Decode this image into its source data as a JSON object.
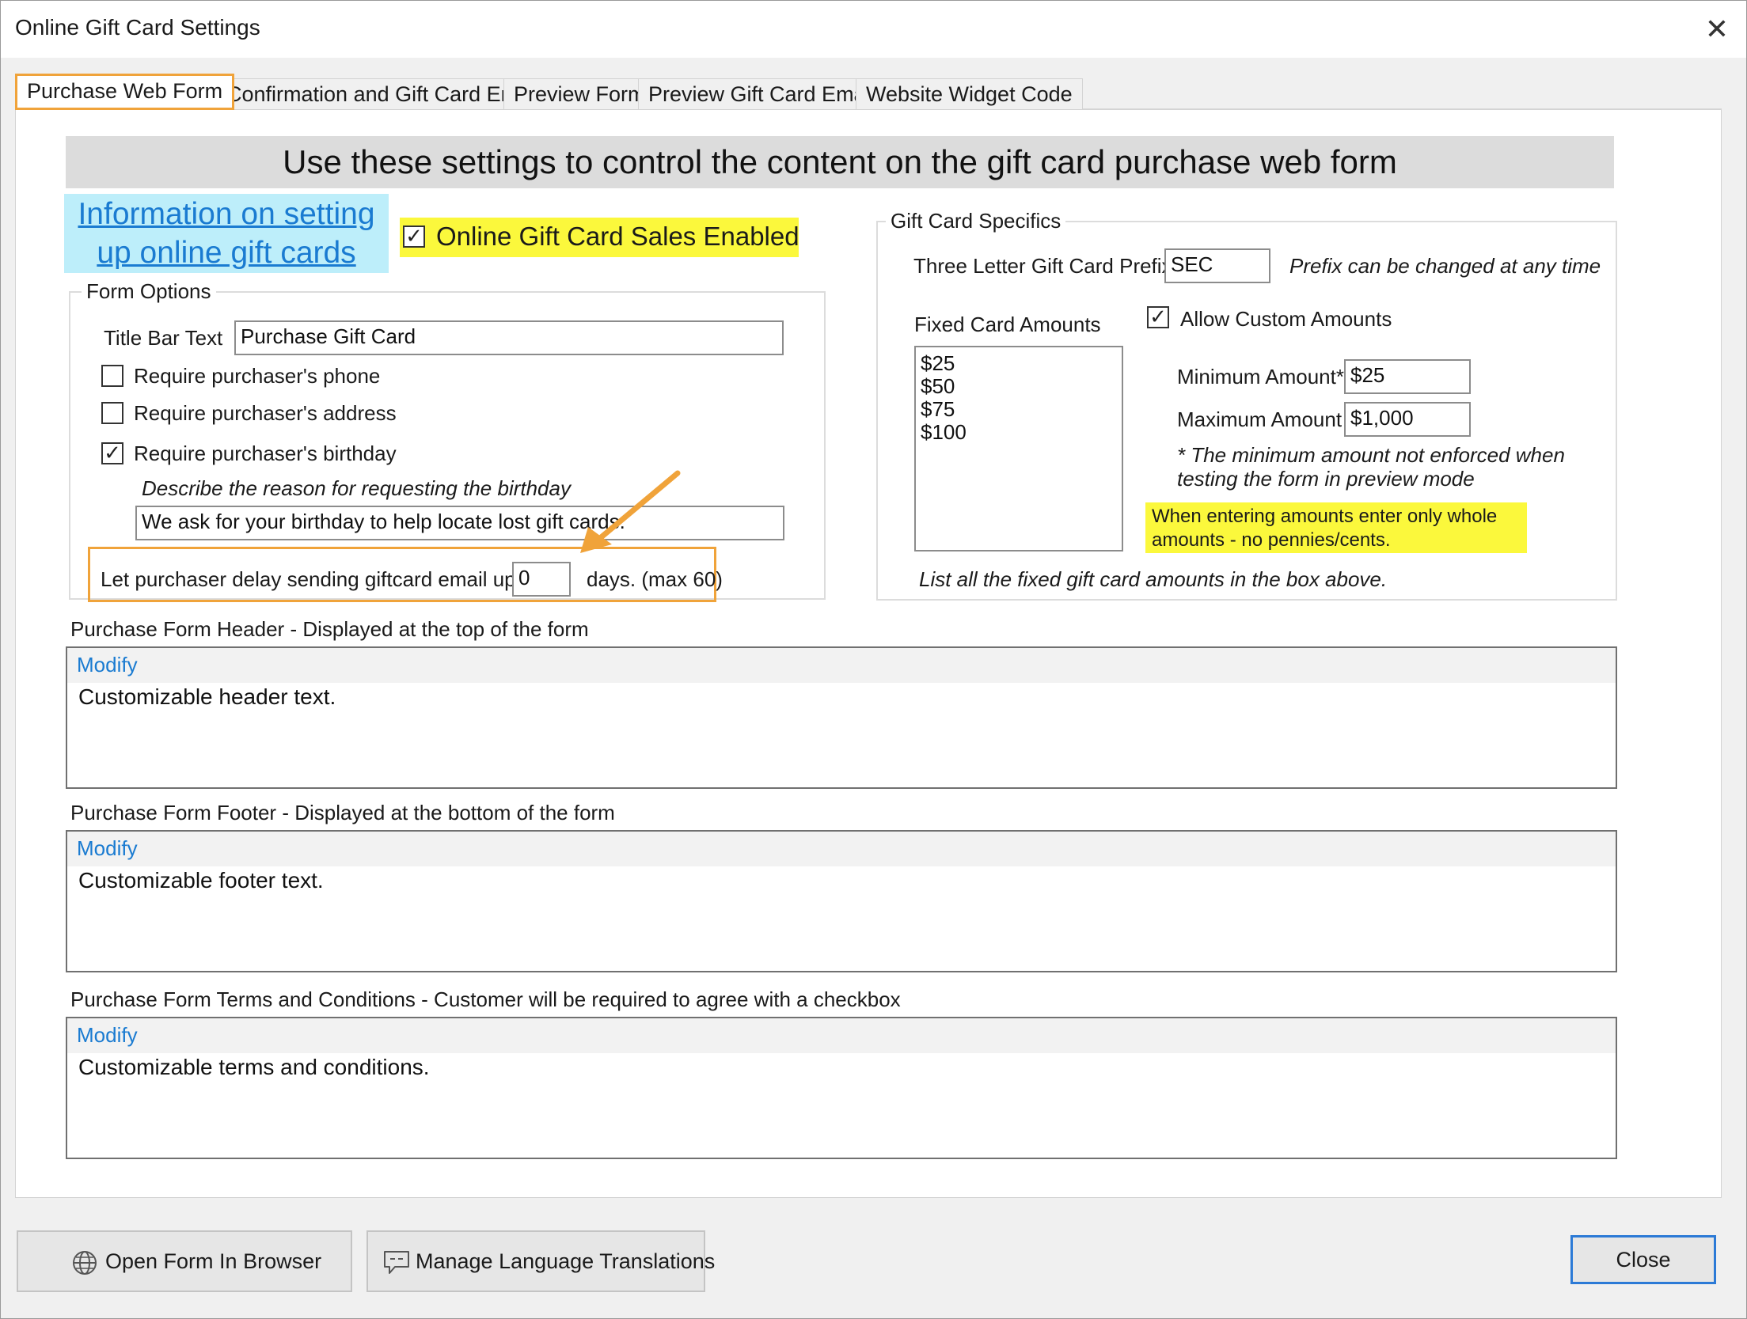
{
  "window": {
    "title": "Online Gift Card Settings"
  },
  "tabs": [
    {
      "label": "Purchase Web Form"
    },
    {
      "label": "Confirmation and Gift Card Email"
    },
    {
      "label": "Preview Form"
    },
    {
      "label": "Preview Gift Card Email"
    },
    {
      "label": "Website Widget Code"
    }
  ],
  "banner": "Use these settings to control the content on the gift card purchase web form",
  "info_link": {
    "line1": "Information on setting",
    "line2": "up online gift cards"
  },
  "sales_enabled": {
    "label": "Online Gift Card Sales Enabled",
    "checked": true,
    "mark": "✓"
  },
  "form_options": {
    "title": "Form Options",
    "title_bar_label": "Title Bar Text",
    "title_bar_value": "Purchase Gift Card",
    "require_phone": {
      "label": "Require purchaser's phone",
      "checked": false,
      "mark": ""
    },
    "require_address": {
      "label": "Require purchaser's address",
      "checked": false,
      "mark": ""
    },
    "require_birthday": {
      "label": "Require purchaser's birthday",
      "checked": true,
      "mark": "✓"
    },
    "birthday_reason_label": "Describe the reason for requesting the birthday",
    "birthday_reason_value": "We ask for your birthday to help locate lost gift cards.",
    "delay_label": "Let purchaser delay sending giftcard email up to",
    "delay_value": "0",
    "delay_suffix": "days. (max 60)"
  },
  "gift_card_specifics": {
    "title": "Gift Card Specifics",
    "prefix_label": "Three Letter Gift Card Prefix",
    "prefix_value": "SEC",
    "prefix_note": "Prefix can be changed at any time",
    "fixed_amounts_label": "Fixed Card Amounts",
    "fixed_amounts": [
      "$25",
      "$50",
      "$75",
      "$100"
    ],
    "allow_custom": {
      "label": "Allow Custom Amounts",
      "checked": true,
      "mark": "✓"
    },
    "min_label": "Minimum Amount*",
    "min_value": "$25",
    "max_label": "Maximum Amount",
    "max_value": "$1,000",
    "min_note_line1": "* The minimum amount not enforced when",
    "min_note_line2": "testing the form in preview mode",
    "whole_note_line1": "When entering amounts enter only whole",
    "whole_note_line2": "amounts - no pennies/cents.",
    "list_note": "List all the fixed gift card amounts in the box above."
  },
  "header_section": {
    "label": "Purchase Form Header - Displayed at the top of the form",
    "modify": "Modify",
    "content": "Customizable header text."
  },
  "footer_section": {
    "label": "Purchase Form Footer - Displayed at the bottom of the form",
    "modify": "Modify",
    "content": "Customizable footer text."
  },
  "terms_section": {
    "label": "Purchase Form Terms and Conditions - Customer will be required to agree with a checkbox",
    "modify": "Modify",
    "content": "Customizable terms and conditions."
  },
  "buttons": {
    "open_browser": "Open Form In Browser",
    "translations": "Manage Language Translations",
    "close": "Close"
  },
  "icons": {
    "close": "close-icon",
    "globe": "globe-icon",
    "translate": "speech-bubble-icon",
    "arrow": "arrow-annotation-icon"
  },
  "colors": {
    "highlight_yellow": "#fbf83c",
    "highlight_cyan": "#bdeefa",
    "annotation_orange": "#f0a33a",
    "link_blue": "#1a7bd1",
    "accent_blue": "#2c7ad6"
  }
}
